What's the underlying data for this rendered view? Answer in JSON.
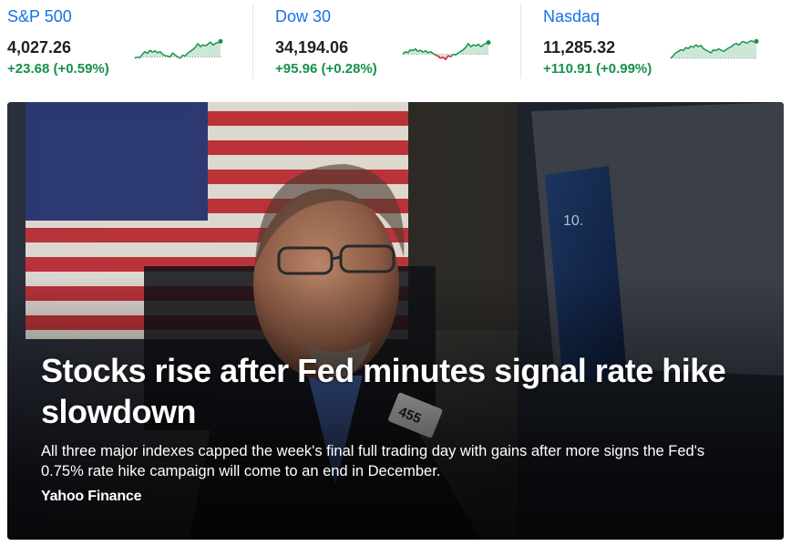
{
  "tickers": [
    {
      "name": "S&P 500",
      "price": "4,027.26",
      "change": "+23.68 (+0.59%)",
      "trend": [
        0.3,
        0.35,
        0.32,
        0.45,
        0.55,
        0.48,
        0.6,
        0.52,
        0.58,
        0.5,
        0.55,
        0.45,
        0.4,
        0.38,
        0.35,
        0.5,
        0.42,
        0.35,
        0.3,
        0.42,
        0.38,
        0.5,
        0.55,
        0.62,
        0.7,
        0.85,
        0.72,
        0.8,
        0.75,
        0.82,
        0.9,
        0.78,
        0.85,
        0.88,
        0.92
      ],
      "baseline": 0.35
    },
    {
      "name": "Dow 30",
      "price": "34,194.06",
      "change": "+95.96 (+0.28%)",
      "trend": [
        0.45,
        0.55,
        0.5,
        0.62,
        0.58,
        0.65,
        0.55,
        0.6,
        0.52,
        0.58,
        0.5,
        0.55,
        0.48,
        0.42,
        0.38,
        0.3,
        0.35,
        0.25,
        0.4,
        0.35,
        0.45,
        0.42,
        0.5,
        0.55,
        0.62,
        0.7,
        0.85,
        0.72,
        0.8,
        0.75,
        0.82,
        0.72,
        0.8,
        0.85,
        0.88
      ],
      "baseline": 0.45
    },
    {
      "name": "Nasdaq",
      "price": "11,285.32",
      "change": "+110.91 (+0.99%)",
      "trend": [
        0.3,
        0.4,
        0.5,
        0.55,
        0.62,
        0.58,
        0.7,
        0.65,
        0.75,
        0.7,
        0.8,
        0.72,
        0.78,
        0.65,
        0.6,
        0.55,
        0.5,
        0.62,
        0.58,
        0.65,
        0.6,
        0.55,
        0.62,
        0.68,
        0.72,
        0.8,
        0.85,
        0.78,
        0.88,
        0.92,
        0.85,
        0.9,
        0.95,
        0.9,
        0.92
      ],
      "baseline": 0.3
    }
  ],
  "colors": {
    "link_blue": "#1672e8",
    "up_green": "#16914a",
    "down_red": "#eb0f29"
  },
  "hero": {
    "headline": "Stocks rise after Fed minutes signal rate hike slowdown",
    "summary": "All three major indexes capped the week's final full trading day with gains after more signs the Fed's 0.75% rate hike campaign will come to an end in December.",
    "source": "Yahoo Finance",
    "badge_text": "455"
  }
}
